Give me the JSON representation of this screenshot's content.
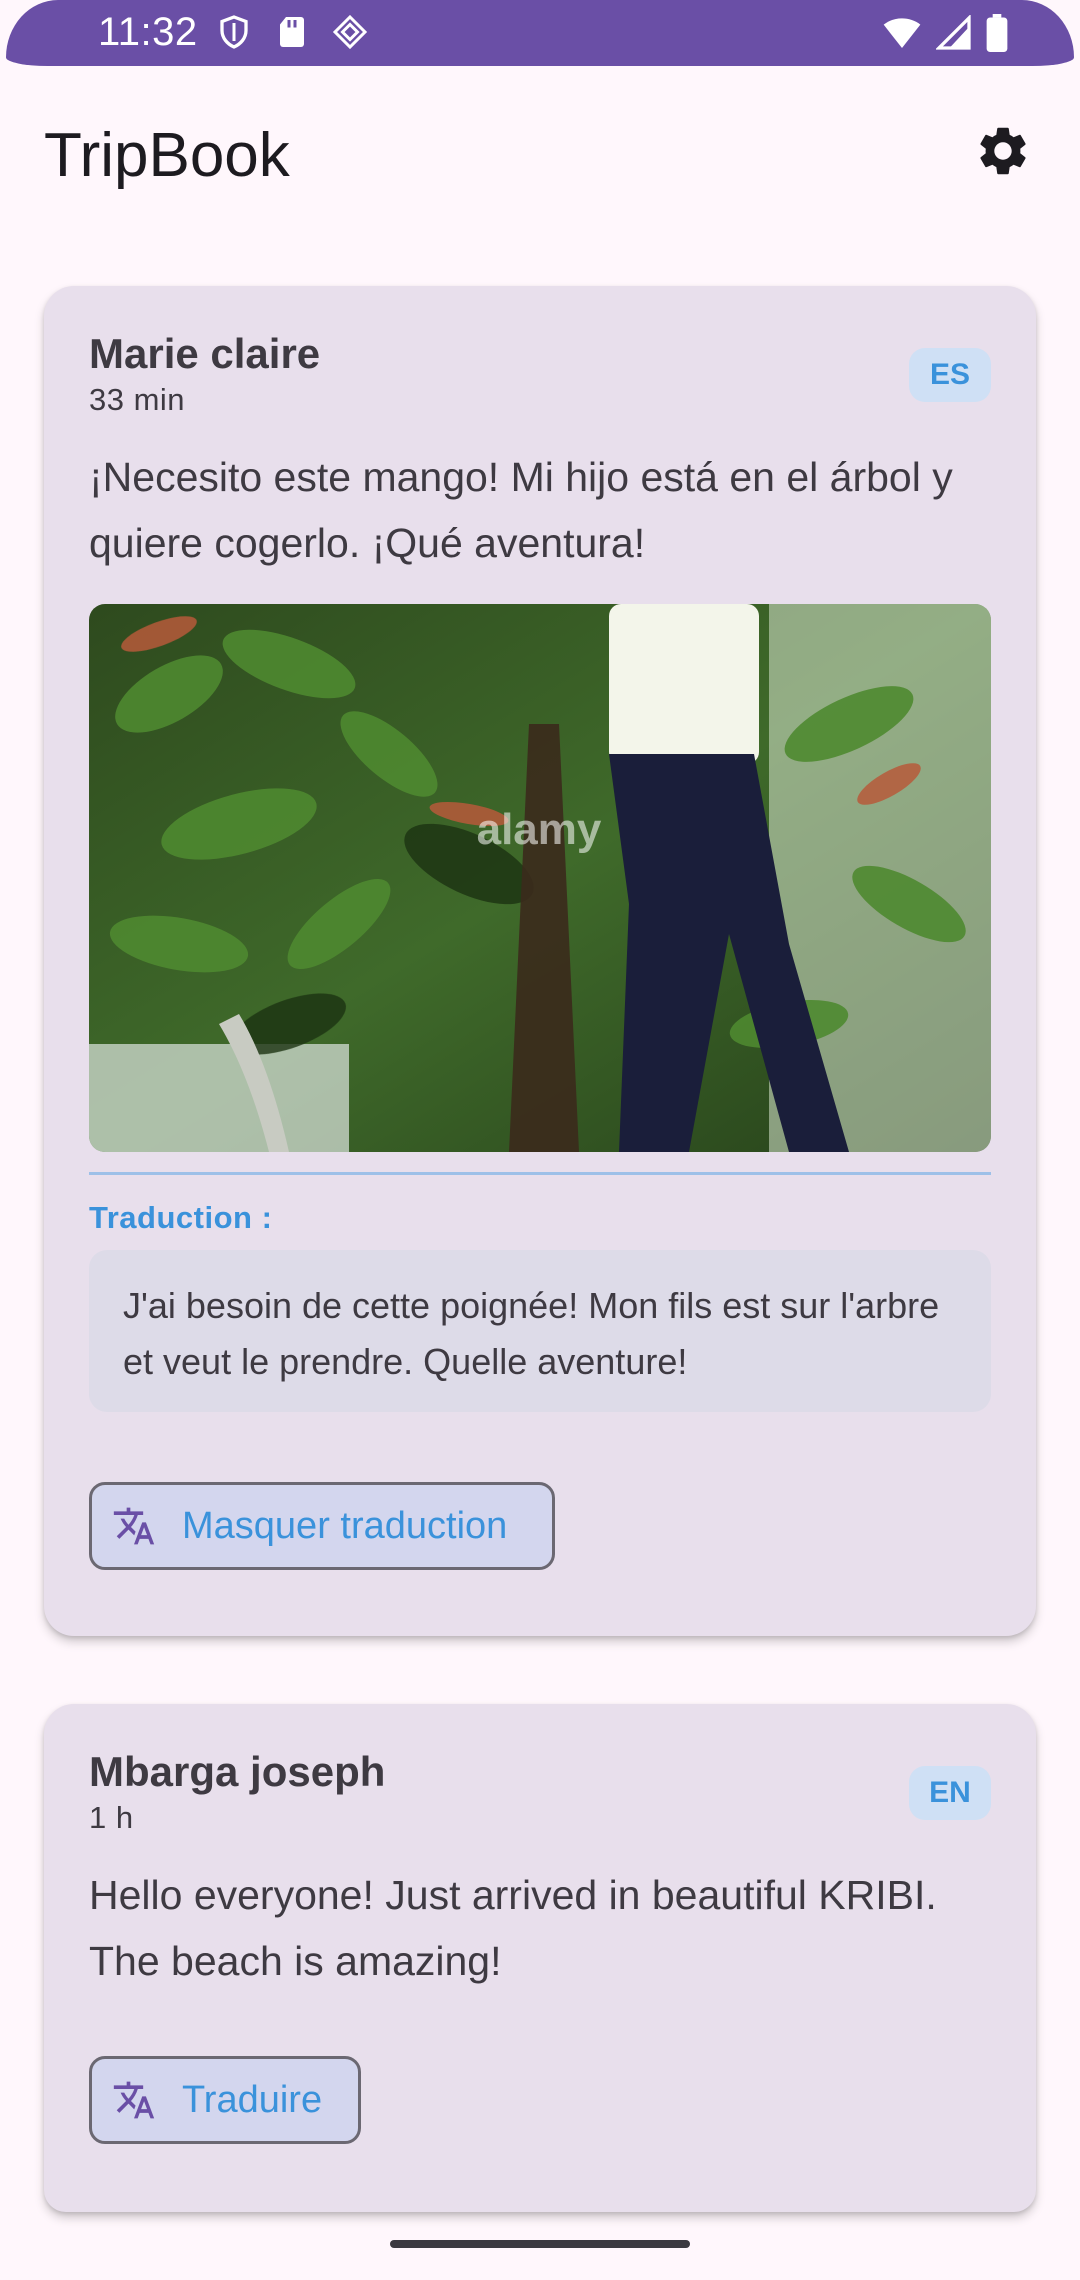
{
  "status_bar": {
    "time": "11:32",
    "icons_left": [
      "shield-icon",
      "sd-card-icon",
      "diamond-icon"
    ],
    "icons_right": [
      "wifi-icon",
      "signal-icon",
      "battery-icon"
    ]
  },
  "app_bar": {
    "title": "TripBook",
    "settings_icon": "gear-icon"
  },
  "posts": [
    {
      "author": "Marie claire",
      "time": "33 min",
      "language": "ES",
      "text": "¡Necesito este mango! Mi hijo está en el árbol y quiere cogerlo. ¡Qué aventura!",
      "has_photo": true,
      "photo_watermark": "alamy",
      "translation_label": "Traduction :",
      "translation": "J'ai besoin de cette poignée! Mon fils est sur l'arbre et veut le prendre. Quelle aventure!",
      "action_label": "Masquer traduction",
      "action_icon": "translate-icon"
    },
    {
      "author": "Mbarga joseph",
      "time": "1 h",
      "language": "EN",
      "text": "Hello everyone! Just arrived in beautiful KRIBI. The beach is amazing!",
      "has_photo": false,
      "action_label": "Traduire",
      "action_icon": "translate-icon"
    }
  ],
  "colors": {
    "status_bar": "#6A4FA6",
    "card": "#E8DFEC",
    "accent": "#3A92DB",
    "badge": "#CFE0F5"
  }
}
